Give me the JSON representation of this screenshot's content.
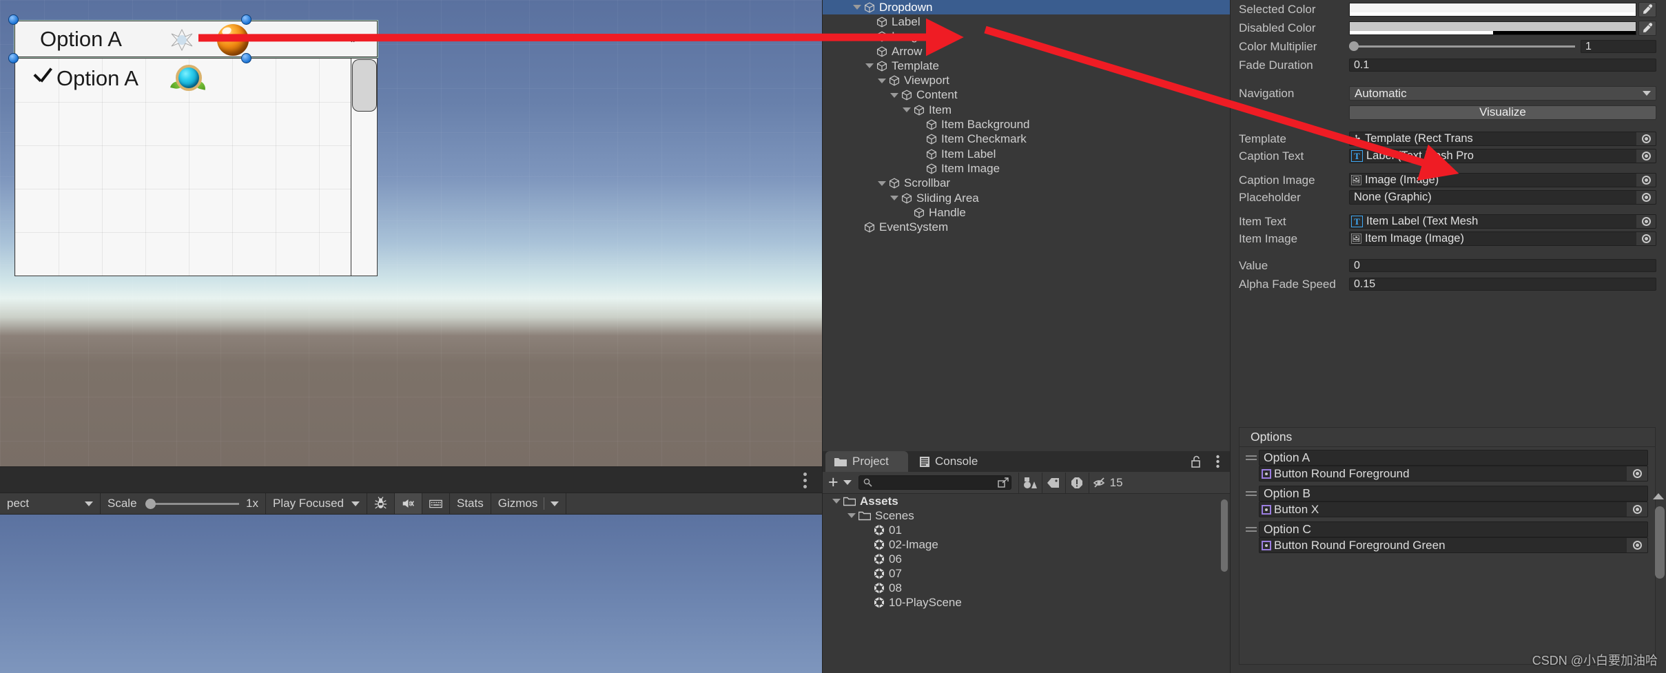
{
  "game_view": {
    "dropdown": {
      "caption_text": "Option A",
      "caption_image_icon": "image-placeholder-icon",
      "caption_sprite_icon": "orange-orb-sprite",
      "arrow_icon": "chevron-down-icon",
      "item": {
        "checkmark_icon": "checkmark-icon",
        "label": "Option A",
        "image_icon": "cyan-orb-sprite"
      }
    },
    "toolbar": {
      "aspect_label": "pect",
      "aspect_caret_icon": "chevron-down-icon",
      "scale_label": "Scale",
      "scale_value": "1x",
      "play_mode_label": "Play Focused",
      "play_mode_caret_icon": "chevron-down-icon",
      "debug_icon": "bug-icon",
      "mute_icon": "mute-audio-icon",
      "keyboard_icon": "keyboard-icon",
      "stats_label": "Stats",
      "gizmos_label": "Gizmos",
      "gizmos_caret_icon": "chevron-down-icon",
      "kebab_icon": "more-options-icon"
    }
  },
  "hierarchy": {
    "rows": [
      {
        "label": "Dropdown",
        "depth": 2,
        "foldout": "open",
        "selected": true
      },
      {
        "label": "Label",
        "depth": 3,
        "foldout": "none",
        "selected": false
      },
      {
        "label": "Image",
        "depth": 3,
        "foldout": "none",
        "selected": false
      },
      {
        "label": "Arrow",
        "depth": 3,
        "foldout": "none",
        "selected": false
      },
      {
        "label": "Template",
        "depth": 3,
        "foldout": "open",
        "selected": false
      },
      {
        "label": "Viewport",
        "depth": 4,
        "foldout": "open",
        "selected": false
      },
      {
        "label": "Content",
        "depth": 5,
        "foldout": "open",
        "selected": false
      },
      {
        "label": "Item",
        "depth": 6,
        "foldout": "open",
        "selected": false
      },
      {
        "label": "Item Background",
        "depth": 7,
        "foldout": "none",
        "selected": false
      },
      {
        "label": "Item Checkmark",
        "depth": 7,
        "foldout": "none",
        "selected": false
      },
      {
        "label": "Item Label",
        "depth": 7,
        "foldout": "none",
        "selected": false
      },
      {
        "label": "Item Image",
        "depth": 7,
        "foldout": "none",
        "selected": false
      },
      {
        "label": "Scrollbar",
        "depth": 4,
        "foldout": "open",
        "selected": false
      },
      {
        "label": "Sliding Area",
        "depth": 5,
        "foldout": "open",
        "selected": false
      },
      {
        "label": "Handle",
        "depth": 6,
        "foldout": "none",
        "selected": false
      },
      {
        "label": "EventSystem",
        "depth": 2,
        "foldout": "none",
        "selected": false
      }
    ]
  },
  "project": {
    "tabs": [
      {
        "label": "Project",
        "icon": "folder-icon",
        "active": true
      },
      {
        "label": "Console",
        "icon": "console-icon",
        "active": false
      }
    ],
    "lock_icon": "unlock-icon",
    "kebab_icon": "more-options-icon",
    "toolbar": {
      "create_icon": "plus-icon",
      "create_caret_icon": "chevron-down-icon",
      "search_placeholder": "",
      "search_value": "",
      "search_icon": "search-icon",
      "open_in_new_icon": "open-external-icon",
      "filter_type_icon": "filter-by-type-icon",
      "filter_label_icon": "filter-by-label-icon",
      "filter_warning_icon": "filter-warning-icon",
      "hidden_count_icon": "hidden-items-icon",
      "hidden_count": "15"
    },
    "tree": [
      {
        "label": "Assets",
        "depth": 0,
        "foldout": "open",
        "icon": "folder-icon",
        "bold": true
      },
      {
        "label": "Scenes",
        "depth": 1,
        "foldout": "open",
        "icon": "folder-icon",
        "bold": false
      },
      {
        "label": "01",
        "depth": 2,
        "foldout": "none",
        "icon": "unity-scene-icon",
        "bold": false
      },
      {
        "label": "02-Image",
        "depth": 2,
        "foldout": "none",
        "icon": "unity-scene-icon",
        "bold": false
      },
      {
        "label": "06",
        "depth": 2,
        "foldout": "none",
        "icon": "unity-scene-icon",
        "bold": false
      },
      {
        "label": "07",
        "depth": 2,
        "foldout": "none",
        "icon": "unity-scene-icon",
        "bold": false
      },
      {
        "label": "08",
        "depth": 2,
        "foldout": "none",
        "icon": "unity-scene-icon",
        "bold": false
      },
      {
        "label": "10-PlayScene",
        "depth": 2,
        "foldout": "none",
        "icon": "unity-scene-icon",
        "bold": false
      }
    ]
  },
  "inspector": {
    "selected_color": {
      "label": "Selected Color",
      "hex": "#f4f4f4",
      "alpha_pct": 100,
      "eyedropper_icon": "eyedropper-icon"
    },
    "disabled_color": {
      "label": "Disabled Color",
      "hex": "#c8c8c8",
      "alpha_pct": 50,
      "eyedropper_icon": "eyedropper-icon"
    },
    "color_multiplier": {
      "label": "Color Multiplier",
      "value": "1",
      "slider_pct": 0
    },
    "fade_duration": {
      "label": "Fade Duration",
      "value": "0.1"
    },
    "navigation": {
      "label": "Navigation",
      "value": "Automatic",
      "caret_icon": "chevron-down-icon"
    },
    "visualize_button": "Visualize",
    "object_fields": [
      {
        "label": "Template",
        "value": "Template (Rect Trans",
        "icon": "rect-transform-icon",
        "picker_icon": "object-picker-icon"
      },
      {
        "label": "Caption Text",
        "value": "Label (Text Mesh Pro",
        "icon": "text-mesh-pro-icon",
        "picker_icon": "object-picker-icon"
      },
      {
        "label": "Caption Image",
        "value": "Image (Image)",
        "icon": "image-component-icon",
        "picker_icon": "object-picker-icon"
      },
      {
        "label": "Placeholder",
        "value": "None (Graphic)",
        "icon": "none-icon",
        "picker_icon": "object-picker-icon"
      },
      {
        "label": "Item Text",
        "value": "Item Label (Text Mesh",
        "icon": "text-mesh-pro-icon",
        "picker_icon": "object-picker-icon"
      },
      {
        "label": "Item Image",
        "value": "Item Image (Image)",
        "icon": "image-component-icon",
        "picker_icon": "object-picker-icon"
      }
    ],
    "value_field": {
      "label": "Value",
      "value": "0"
    },
    "alpha_fade_speed": {
      "label": "Alpha Fade Speed",
      "value": "0.15"
    },
    "options": {
      "header": "Options",
      "items": [
        {
          "text": "Option A",
          "sprite": "Button Round Foreground",
          "grip_icon": "drag-handle-icon",
          "sprite_icon": "sprite-icon",
          "picker_icon": "object-picker-icon"
        },
        {
          "text": "Option B",
          "sprite": "Button X",
          "grip_icon": "drag-handle-icon",
          "sprite_icon": "sprite-icon",
          "picker_icon": "object-picker-icon"
        },
        {
          "text": "Option C",
          "sprite": "Button Round Foreground Green",
          "grip_icon": "drag-handle-icon",
          "sprite_icon": "sprite-icon",
          "picker_icon": "object-picker-icon"
        }
      ]
    }
  },
  "annotations": {
    "arrow_color": "#ef1c24",
    "arrow_1_target": "Image (hierarchy)",
    "arrow_2_target": "Caption Image field"
  },
  "watermark": "CSDN @小白要加油哈"
}
